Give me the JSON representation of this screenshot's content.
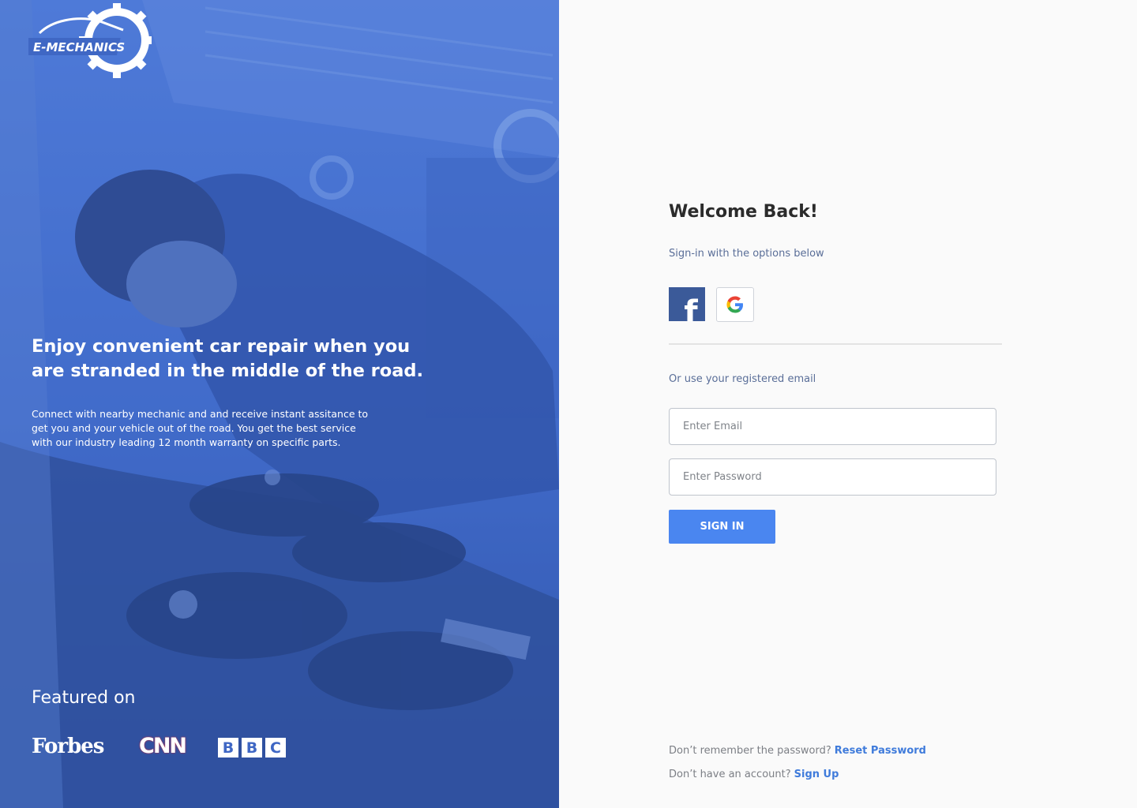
{
  "hero": {
    "logo_text": "E-MECHANICS",
    "headline": "Enjoy convenient car repair when you are stranded in the middle of the road.",
    "body": "Connect with nearby mechanic and and receive instant assitance to get you and your vehicle out of the road. You get the best service with our industry leading 12 month warranty on specific parts.",
    "featured_title": "Featured on",
    "brands": {
      "forbes": "Forbes",
      "cnn": "CNN",
      "bbc": [
        "B",
        "B",
        "C"
      ]
    },
    "overlay_color": "#3f67c4"
  },
  "form": {
    "title": "Welcome Back!",
    "subtitle": "Sign-in with the options below",
    "social": {
      "facebook_icon": "facebook-icon",
      "google_icon": "google-icon",
      "facebook_label": "f",
      "google_label": "G"
    },
    "alt_text": "Or use your registered email",
    "email_placeholder": "Enter Email",
    "password_placeholder": "Enter Password",
    "signin_label": "SIGN IN",
    "reset_prompt": "Don’t remember the password?",
    "reset_link": "Reset Password",
    "signup_prompt": "Don’t have an account?",
    "signup_link": "Sign Up",
    "accent_color": "#4a86f0"
  }
}
